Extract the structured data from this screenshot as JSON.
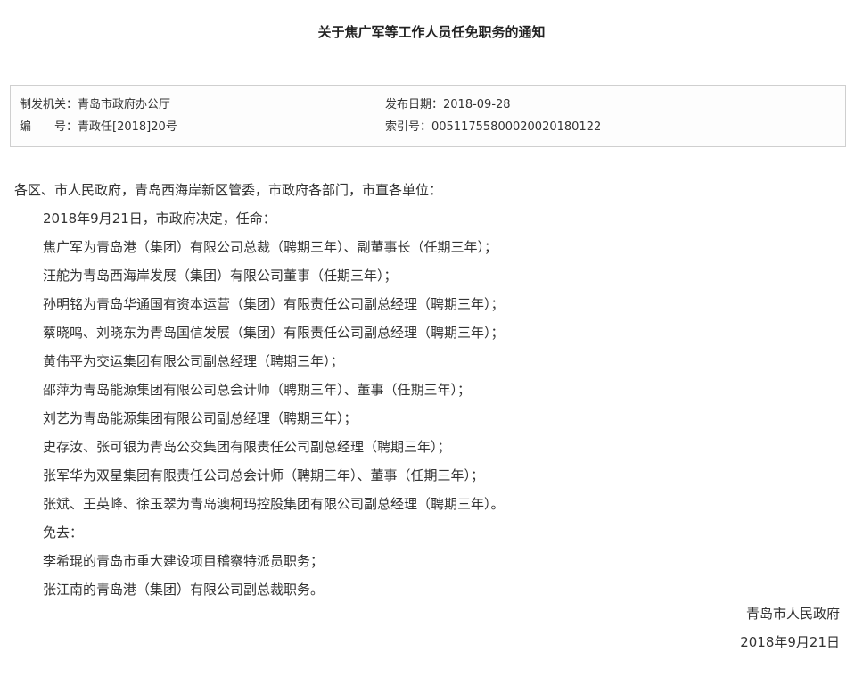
{
  "title": "关于焦广军等工作人员任免职务的通知",
  "meta": {
    "issuer_label": "制发机关：",
    "issuer": "青岛市政府办公厅",
    "date_label": "发布日期：",
    "date": "2018-09-28",
    "docno_label": "编　　号：",
    "docno": "青政任[2018]20号",
    "index_label": "索引号：",
    "index": "00511755800020020180122"
  },
  "body": {
    "salutation": "各区、市人民政府，青岛西海岸新区管委，市政府各部门，市直各单位：",
    "paragraphs": [
      "2018年9月21日，市政府决定，任命：",
      "焦广军为青岛港（集团）有限公司总裁（聘期三年）、副董事长（任期三年）；",
      "汪舵为青岛西海岸发展（集团）有限公司董事（任期三年）；",
      "孙明铭为青岛华通国有资本运营（集团）有限责任公司副总经理（聘期三年）；",
      "蔡晓鸣、刘晓东为青岛国信发展（集团）有限责任公司副总经理（聘期三年）；",
      "黄伟平为交运集团有限公司副总经理（聘期三年）；",
      "邵萍为青岛能源集团有限公司总会计师（聘期三年）、董事（任期三年）；",
      "刘艺为青岛能源集团有限公司副总经理（聘期三年）；",
      "史存汝、张可银为青岛公交集团有限责任公司副总经理（聘期三年）；",
      "张军华为双星集团有限责任公司总会计师（聘期三年）、董事（任期三年）；",
      "张斌、王英峰、徐玉翠为青岛澳柯玛控股集团有限公司副总经理（聘期三年）。",
      "免去：",
      "李希琨的青岛市重大建设项目稽察特派员职务；",
      "张江南的青岛港（集团）有限公司副总裁职务。"
    ]
  },
  "signature": {
    "org": "青岛市人民政府",
    "date": "2018年9月21日"
  }
}
